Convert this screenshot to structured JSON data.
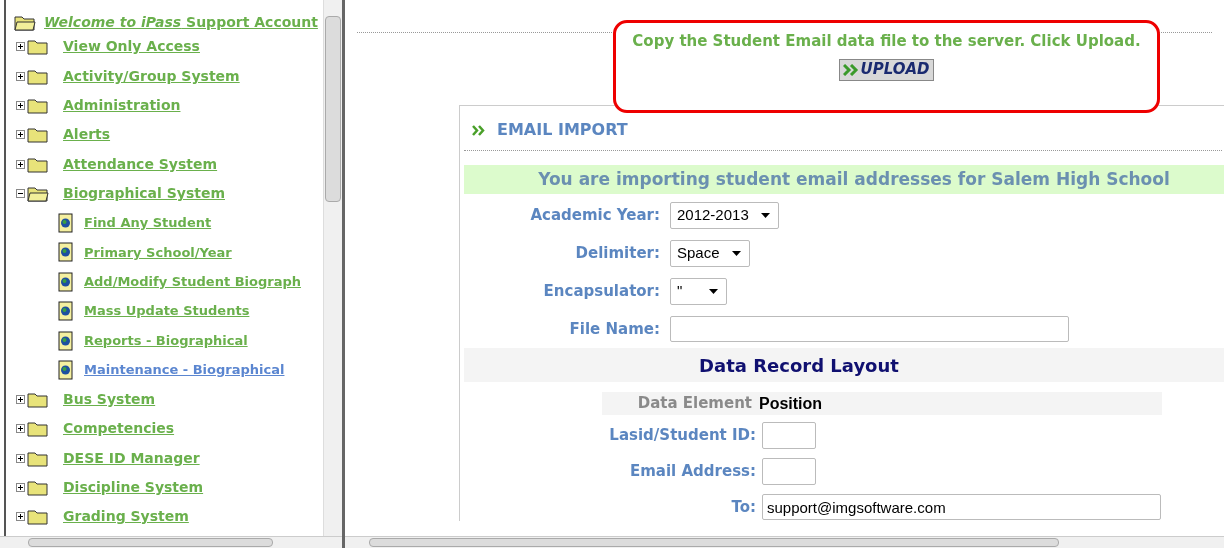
{
  "sidebar": {
    "header": "*Welcome to iPass* Support Account",
    "items": [
      {
        "label": "View Only Access",
        "expanded": false
      },
      {
        "label": "Activity/Group System",
        "expanded": false
      },
      {
        "label": "Administration",
        "expanded": false
      },
      {
        "label": "Alerts",
        "expanded": false
      },
      {
        "label": "Attendance System",
        "expanded": false
      },
      {
        "label": "Biographical System",
        "expanded": true,
        "children": [
          {
            "label": "Find Any Student",
            "visited": false
          },
          {
            "label": "Primary School/Year",
            "visited": false
          },
          {
            "label": "Add/Modify Student Biograph",
            "visited": false
          },
          {
            "label": "Mass Update Students",
            "visited": false
          },
          {
            "label": "Reports - Biographical",
            "visited": false
          },
          {
            "label": "Maintenance - Biographical",
            "visited": true
          }
        ]
      },
      {
        "label": "Bus System",
        "expanded": false
      },
      {
        "label": "Competencies",
        "expanded": false
      },
      {
        "label": "DESE ID Manager",
        "expanded": false
      },
      {
        "label": "Discipline System",
        "expanded": false
      },
      {
        "label": "Grading System",
        "expanded": false
      }
    ]
  },
  "callout": {
    "message": "Copy the Student Email data file to the server. Click Upload.",
    "button": "UPLOAD"
  },
  "panel": {
    "title": "EMAIL IMPORT",
    "banner": "You are importing student email addresses for Salem High School",
    "fields": [
      {
        "kind": "select",
        "label": "Academic Year:",
        "value": "2012-2013"
      },
      {
        "kind": "select",
        "label": "Delimiter:",
        "value": "Space"
      },
      {
        "kind": "select",
        "label": "Encapsulator:",
        "value": "\""
      },
      {
        "kind": "text",
        "label": "File Name:"
      }
    ],
    "layout_title": "Data Record Layout",
    "layout_columns": [
      "Data Element",
      "Position"
    ],
    "layout_rows": [
      {
        "kind": "short",
        "label": "Lasid/Student ID:"
      },
      {
        "kind": "short",
        "label": "Email Address:"
      },
      {
        "kind": "long",
        "label": "To:",
        "value": "support@imgsoftware.com"
      }
    ]
  }
}
